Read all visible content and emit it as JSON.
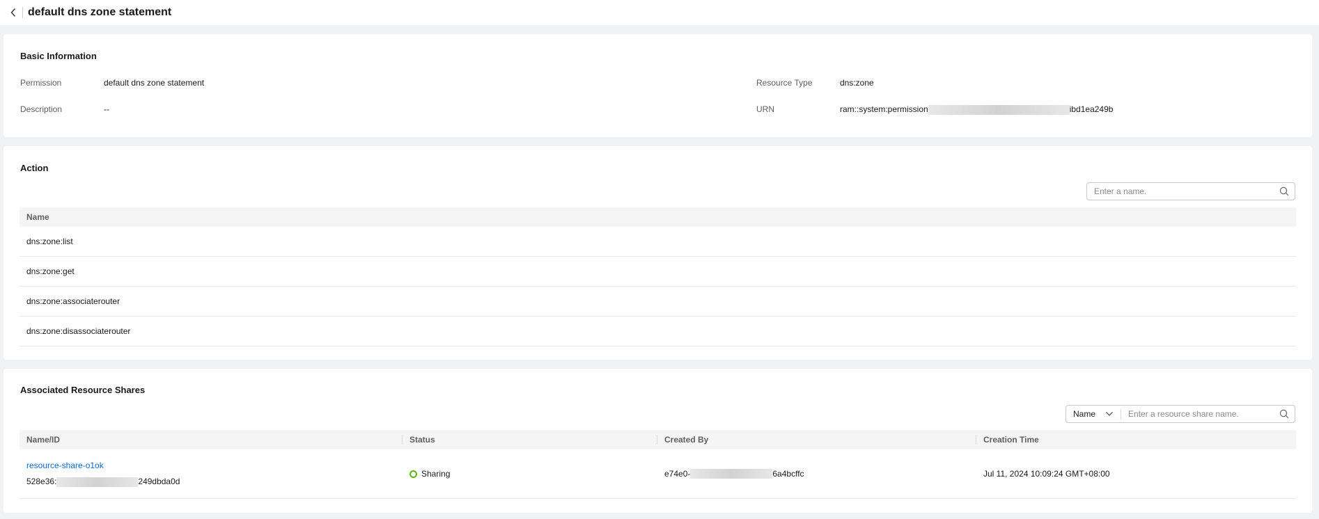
{
  "page": {
    "title": "default dns zone statement"
  },
  "basic_info": {
    "title": "Basic Information",
    "permission_label": "Permission",
    "permission_value": "default dns zone statement",
    "description_label": "Description",
    "description_value": "--",
    "resource_type_label": "Resource Type",
    "resource_type_value": "dns:zone",
    "urn_label": "URN",
    "urn_prefix": "ram::system:permission",
    "urn_suffix": "ibd1ea249b"
  },
  "action": {
    "title": "Action",
    "search_placeholder": "Enter a name.",
    "column_name": "Name",
    "rows": [
      "dns:zone:list",
      "dns:zone:get",
      "dns:zone:associaterouter",
      "dns:zone:disassociaterouter"
    ]
  },
  "shares": {
    "title": "Associated Resource Shares",
    "filter_select": "Name",
    "search_placeholder": "Enter a resource share name.",
    "columns": {
      "name_id": "Name/ID",
      "status": "Status",
      "created_by": "Created By",
      "creation_time": "Creation Time"
    },
    "rows": [
      {
        "name": "resource-share-o1ok",
        "id_prefix": "528e36:",
        "id_suffix": "249dbda0d",
        "status": "Sharing",
        "created_by_prefix": "e74e0-",
        "created_by_suffix": "6a4bcffc",
        "creation_time": "Jul 11, 2024 10:09:24 GMT+08:00"
      }
    ]
  },
  "colors": {
    "link": "#0a68d3",
    "status_ok": "#5cb300"
  }
}
